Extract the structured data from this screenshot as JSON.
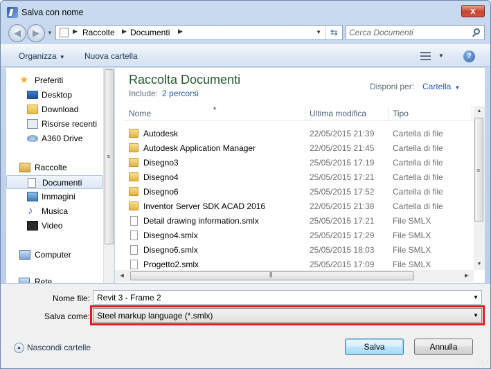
{
  "window": {
    "title": "Salva con nome",
    "close_glyph": "x"
  },
  "address": {
    "segments": [
      "Raccolte",
      "Documenti"
    ],
    "separator": "▶"
  },
  "search": {
    "placeholder": "Cerca Documenti"
  },
  "toolbar": {
    "organize": "Organizza",
    "new_folder": "Nuova cartella",
    "help": "?"
  },
  "nav": {
    "favorites": {
      "label": "Preferiti",
      "items": [
        "Desktop",
        "Download",
        "Risorse recenti",
        "A360 Drive"
      ]
    },
    "libraries": {
      "label": "Raccolte",
      "items": [
        "Documenti",
        "Immagini",
        "Musica",
        "Video"
      ],
      "selected": "Documenti"
    },
    "computer": "Computer",
    "partial_item": "Rete"
  },
  "library": {
    "title": "Raccolta Documenti",
    "include_label": "Include:",
    "include_link": "2 percorsi",
    "arrange_label": "Disponi per:",
    "arrange_value": "Cartella"
  },
  "columns": {
    "name": "Nome",
    "modified": "Ultima modifica",
    "type": "Tipo"
  },
  "files": [
    {
      "name": "Autodesk",
      "date": "22/05/2015 21:39",
      "type": "Cartella di file",
      "kind": "folder"
    },
    {
      "name": "Autodesk Application Manager",
      "date": "22/05/2015 21:45",
      "type": "Cartella di file",
      "kind": "folder"
    },
    {
      "name": "Disegno3",
      "date": "25/05/2015 17:19",
      "type": "Cartella di file",
      "kind": "folder"
    },
    {
      "name": "Disegno4",
      "date": "25/05/2015 17:21",
      "type": "Cartella di file",
      "kind": "folder"
    },
    {
      "name": "Disegno6",
      "date": "25/05/2015 17:52",
      "type": "Cartella di file",
      "kind": "folder"
    },
    {
      "name": "Inventor Server SDK ACAD 2016",
      "date": "22/05/2015 21:38",
      "type": "Cartella di file",
      "kind": "folder"
    },
    {
      "name": "Detail drawing information.smlx",
      "date": "25/05/2015 17:21",
      "type": "File SMLX",
      "kind": "file"
    },
    {
      "name": "Disegno4.smlx",
      "date": "25/05/2015 17:29",
      "type": "File SMLX",
      "kind": "file"
    },
    {
      "name": "Disegno6.smlx",
      "date": "25/05/2015 18:03",
      "type": "File SMLX",
      "kind": "file"
    },
    {
      "name": "Progetto2.smlx",
      "date": "25/05/2015 17:09",
      "type": "File SMLX",
      "kind": "file"
    }
  ],
  "form": {
    "filename_label": "Nome file:",
    "filename_value": "Revit 3 - Frame 2",
    "savetype_label": "Salva come:",
    "savetype_value": "Steel markup language (*.smlx)"
  },
  "footer": {
    "hide_folders": "Nascondi cartelle",
    "save": "Salva",
    "cancel": "Annulla"
  },
  "colors": {
    "highlight": "#e21d1d",
    "library_title": "#1e5c2a",
    "link": "#1f57b5"
  },
  "icons": {
    "favorites": "star-icon",
    "desktop": "desktop-icon",
    "download": "download-folder-icon",
    "recent": "recent-places-icon",
    "a360": "cloud-drive-icon",
    "libraries": "libraries-icon",
    "documents": "documents-icon",
    "images": "pictures-icon",
    "music": "music-icon",
    "video": "video-icon",
    "computer": "computer-icon"
  }
}
